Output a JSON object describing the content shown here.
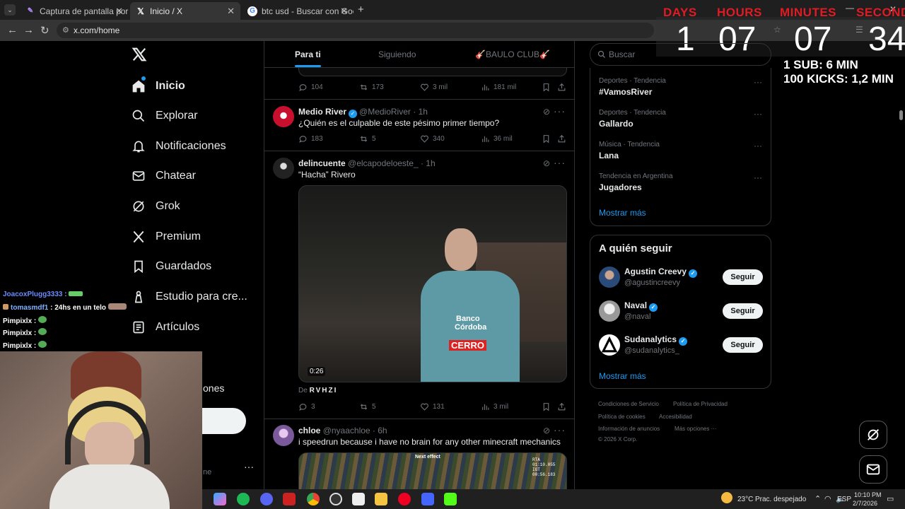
{
  "browser": {
    "tabs": [
      {
        "title": "Captura de pantalla por Lightsh",
        "icon": "feather-icon",
        "active": false
      },
      {
        "title": "Inicio / X",
        "icon": "x-logo-icon",
        "active": true
      },
      {
        "title": "btc usd - Buscar con Google",
        "icon": "google-icon",
        "active": false
      }
    ],
    "new_tab": "+",
    "url": "x.com/home"
  },
  "countdown": {
    "labels": [
      "DAYS",
      "HOURS",
      "MINUTES",
      "SECONDS"
    ],
    "values": [
      "1",
      "07",
      "07",
      "34"
    ],
    "info1": "1 SUB: 6 MIN",
    "info2": "100 KICKS: 1,2 MIN",
    "label_color": "#e01b24"
  },
  "nav": {
    "items": [
      {
        "label": "Inicio",
        "icon": "home-icon"
      },
      {
        "label": "Explorar",
        "icon": "search-icon"
      },
      {
        "label": "Notificaciones",
        "icon": "bell-icon"
      },
      {
        "label": "Chatear",
        "icon": "mail-icon"
      },
      {
        "label": "Grok",
        "icon": "grok-icon"
      },
      {
        "label": "Premium",
        "icon": "x-logo-icon"
      },
      {
        "label": "Guardados",
        "icon": "bookmark-icon"
      },
      {
        "label": "Estudio para cre...",
        "icon": "studio-icon"
      },
      {
        "label": "Artículos",
        "icon": "article-icon"
      }
    ],
    "partial_more": "ones",
    "partial_profile": "ne",
    "profile_more": "···"
  },
  "feed": {
    "tabs": [
      "Para ti",
      "Siguiendo",
      "🎸BAULO CLUB🎸"
    ],
    "top_actions": {
      "replies": "104",
      "reposts": "173",
      "likes": "3 mil",
      "views": "181 mil"
    },
    "tweets": [
      {
        "name": "Medio River",
        "verified": true,
        "handle": "@MedioRiver",
        "time": "· 1h",
        "text": "¿Quién es el culpable de este pésimo primer tiempo?",
        "replies": "183",
        "reposts": "5",
        "likes": "340",
        "views": "36 mil"
      },
      {
        "name": "delincuente",
        "verified": false,
        "handle": "@elcapodeloeste_",
        "time": "· 1h",
        "text": "“Hacha” Rivero",
        "video_duration": "0:26",
        "video_source_prefix": "De ",
        "video_source": "RVHZI",
        "shirt_text1": "Banco",
        "shirt_text2": "Córdoba",
        "shirt_text3": "CERRO",
        "replies": "3",
        "reposts": "5",
        "likes": "131",
        "views": "3 mil"
      },
      {
        "name": "chloe",
        "verified": false,
        "handle": "@nyaachloe",
        "time": "· 6h",
        "text": "i speedrun because i have no brain for any other minecraft mechanics",
        "media_label": "Next effect",
        "media_stats": "RTA 01:10.055 IGT 00:56.183"
      }
    ]
  },
  "sidebar": {
    "search_placeholder": "Buscar",
    "trends": [
      {
        "meta": "Deportes · Tendencia",
        "name": "#VamosRiver"
      },
      {
        "meta": "Deportes · Tendencia",
        "name": "Gallardo"
      },
      {
        "meta": "Música · Tendencia",
        "name": "Lana"
      },
      {
        "meta": "Tendencia en Argentina",
        "name": "Jugadores"
      }
    ],
    "trends_more": "Mostrar más",
    "who_to_follow_title": "A quién seguir",
    "follow": [
      {
        "name": "Agustin Creevy",
        "handle": "@agustincreevy",
        "button": "Seguir"
      },
      {
        "name": "Naval",
        "handle": "@naval",
        "button": "Seguir"
      },
      {
        "name": "Sudanalytics",
        "handle": "@sudanalytics_",
        "button": "Seguir"
      }
    ],
    "follow_more": "Mostrar más",
    "footer": [
      "Condiciones de Servicio",
      "Política de Privacidad",
      "Política de cookies",
      "Accesibilidad",
      "Información de anuncios",
      "Más opciones ···",
      "© 2026 X Corp."
    ]
  },
  "chat": [
    {
      "user": "JoacoxPlugg3333",
      "msg": ":"
    },
    {
      "user": "tomasmdf1",
      "msg": ": 24hs en un telo"
    },
    {
      "user": "Pimpixlx",
      "msg": ":"
    },
    {
      "user": "Pimpixlx",
      "msg": ":"
    },
    {
      "user": "Pimpixlx",
      "msg": ":"
    }
  ],
  "taskbar": {
    "weather": "23°C",
    "weather_text": "Prac. despejado",
    "lang": "ESP",
    "time": "10:10 PM",
    "date": "2/7/2026"
  },
  "colors": {
    "accent": "#1d9bf0",
    "border": "#2f3336",
    "muted": "#71767b"
  }
}
